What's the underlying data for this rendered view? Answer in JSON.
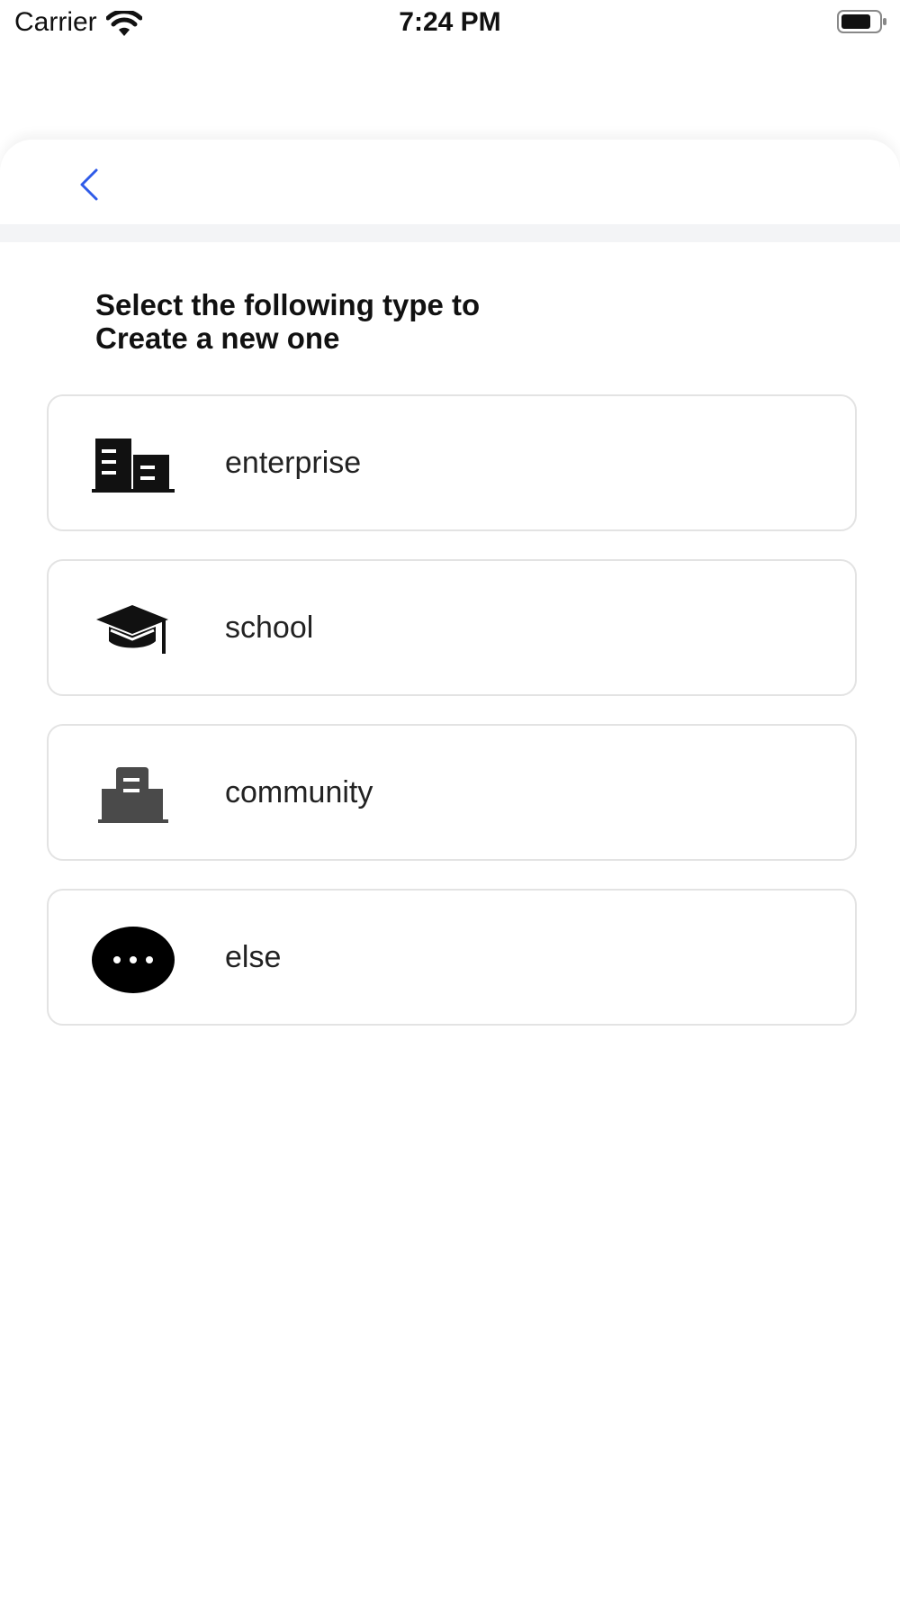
{
  "status_bar": {
    "carrier": "Carrier",
    "time": "7:24 PM",
    "icons": [
      "wifi-icon",
      "battery-icon"
    ]
  },
  "nav": {
    "back_icon": "chevron-left-icon",
    "accent_color": "#2f5be8"
  },
  "heading": {
    "line1": "Select the following type to",
    "line2": "Create a new one"
  },
  "options": [
    {
      "label": "enterprise",
      "icon": "building-icon"
    },
    {
      "label": "school",
      "icon": "graduation-cap-icon"
    },
    {
      "label": "community",
      "icon": "community-building-icon"
    },
    {
      "label": "else",
      "icon": "more-dots-icon"
    }
  ],
  "colors": {
    "card_border": "#e3e3e3",
    "divider": "#f3f4f6",
    "text": "#111111"
  }
}
